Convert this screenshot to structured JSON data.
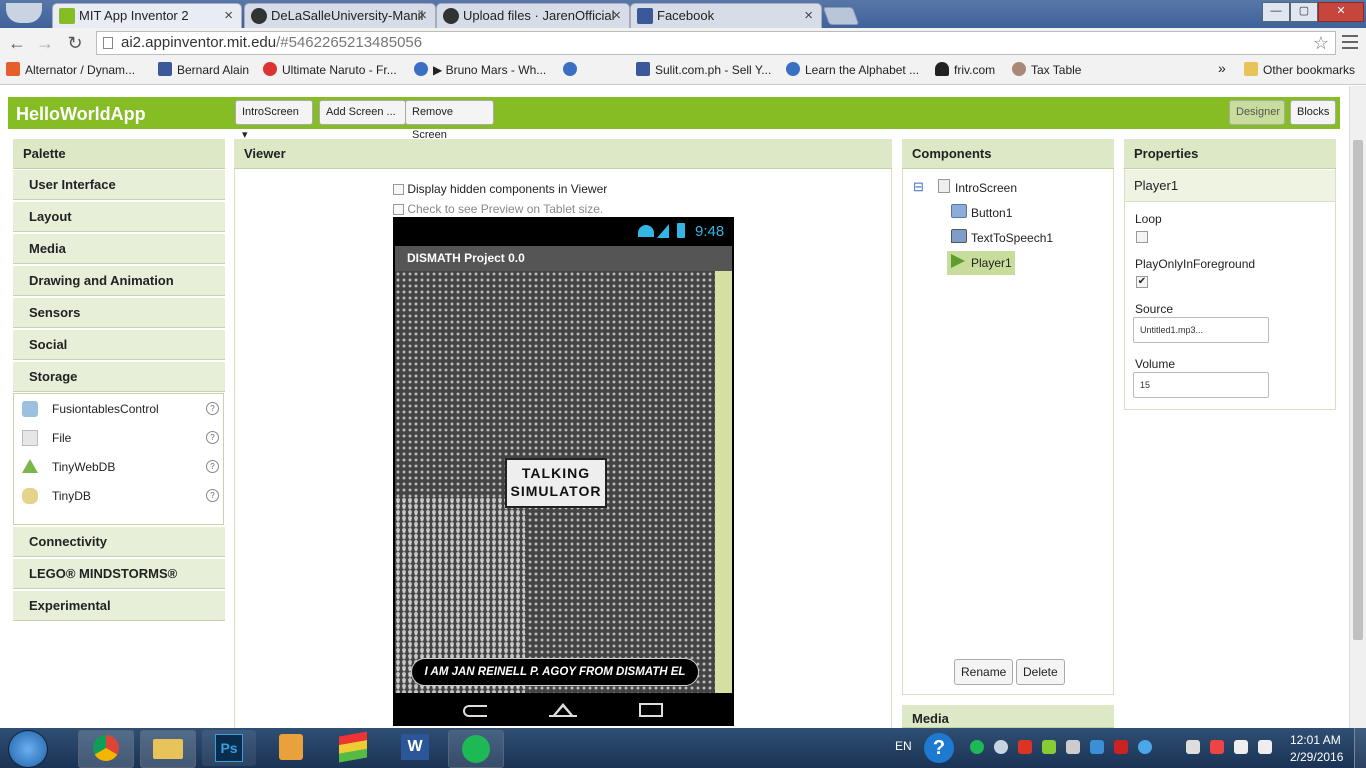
{
  "browser": {
    "tabs": [
      {
        "title": "MIT App Inventor 2",
        "icon": "app-inventor-icon"
      },
      {
        "title": "DeLaSalleUniversity-Manil",
        "icon": "github-icon"
      },
      {
        "title": "Upload files · JarenOfficial",
        "icon": "github-icon"
      },
      {
        "title": "Facebook",
        "icon": "facebook-icon"
      }
    ],
    "url_host": "ai2.appinventor.mit.edu",
    "url_path": "/#5462265213485056",
    "bookmarks": [
      {
        "label": "Alternator / Dynam...",
        "icon": "olx-icon",
        "color": "#e65e2b"
      },
      {
        "label": "Bernard Alain",
        "icon": "facebook-icon",
        "color": "#3b5998"
      },
      {
        "label": "Ultimate Naruto - Fr...",
        "icon": "naruto-icon",
        "color": "#d33"
      },
      {
        "label": "▶ Bruno Mars - Wh...",
        "icon": "globe-icon",
        "color": "#3a6fc4"
      },
      {
        "label": "Sulit.com.ph - Sell Y...",
        "icon": "facebook-icon",
        "color": "#3b5998"
      },
      {
        "label": "Learn the Alphabet ...",
        "icon": "globe-icon",
        "color": "#3a6fc4"
      },
      {
        "label": "friv.com",
        "icon": "friv-icon",
        "color": "#222"
      },
      {
        "label": "Tax Table",
        "icon": "tax-icon",
        "color": "#a87"
      }
    ],
    "more_bookmarks": "»",
    "other_bookmarks": "Other bookmarks"
  },
  "app": {
    "project_name": "HelloWorldApp",
    "screen_select": "IntroScreen ▾",
    "add_screen": "Add Screen ...",
    "remove_screen": "Remove Screen",
    "designer": "Designer",
    "blocks": "Blocks",
    "accent": "#86bc24"
  },
  "palette": {
    "title": "Palette",
    "groups_top": [
      "User Interface",
      "Layout",
      "Media",
      "Drawing and Animation",
      "Sensors",
      "Social",
      "Storage"
    ],
    "storage_items": [
      {
        "label": "FusiontablesControl",
        "icon": "fusiontables-icon"
      },
      {
        "label": "File",
        "icon": "file-icon"
      },
      {
        "label": "TinyWebDB",
        "icon": "tinywebdb-icon"
      },
      {
        "label": "TinyDB",
        "icon": "tinydb-icon"
      }
    ],
    "help": "?",
    "groups_bottom": [
      "Connectivity",
      "LEGO® MINDSTORMS®",
      "Experimental"
    ]
  },
  "viewer": {
    "title": "Viewer",
    "hidden_label": "Display hidden components in Viewer",
    "tablet_label": "Check to see Preview on Tablet size.",
    "phone_time": "9:48",
    "screen_title": "DISMATH Project 0.0",
    "logo_line1": "TALKING",
    "logo_line2": "SIMULATOR",
    "button_text": "I AM JAN REINELL P. AGOY FROM DISMATH EL"
  },
  "components": {
    "title": "Components",
    "collapse": "⊟",
    "root": "IntroScreen",
    "children": [
      {
        "label": "Button1",
        "icon": "button-icon"
      },
      {
        "label": "TextToSpeech1",
        "icon": "texttospeech-icon"
      },
      {
        "label": "Player1",
        "icon": "player-icon",
        "selected": true
      }
    ],
    "rename": "Rename",
    "delete": "Delete"
  },
  "media": {
    "title": "Media"
  },
  "properties": {
    "title": "Properties",
    "component": "Player1",
    "loop_label": "Loop",
    "loop_checked": false,
    "foreground_label": "PlayOnlyInForeground",
    "foreground_checked": true,
    "foreground_check": "✔",
    "source_label": "Source",
    "source_value": "Untitled1.mp3...",
    "volume_label": "Volume",
    "volume_value": "15"
  },
  "taskbar": {
    "lang": "EN",
    "help": "?",
    "time": "12:01 AM",
    "date": "2/29/2016",
    "ps_label": "Ps",
    "word_label": "W"
  }
}
